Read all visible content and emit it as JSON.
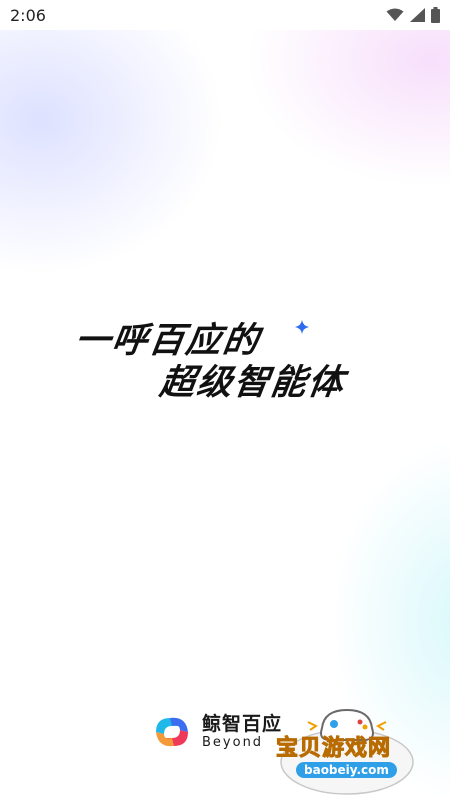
{
  "status_bar": {
    "time": "2:06",
    "icons": [
      "wifi-icon",
      "signal-icon",
      "battery-icon"
    ]
  },
  "hero": {
    "line1": "一呼百应的",
    "line2": "超级智能体",
    "sparkle_icon": "sparkle-icon",
    "sparkle_color": "#2f6bf0"
  },
  "brand": {
    "name": "鲸智百应",
    "subtitle": "Beyond",
    "logo_icon": "whale-knot-logo"
  },
  "watermark": {
    "title": "宝贝游戏网",
    "url": "baobeiy.com",
    "icon": "gamepad-icon"
  },
  "colors": {
    "text": "#111111",
    "accent_blue": "#2f6bf0",
    "watermark_orange": "#f0a000",
    "watermark_blue": "#2fa0e8"
  }
}
